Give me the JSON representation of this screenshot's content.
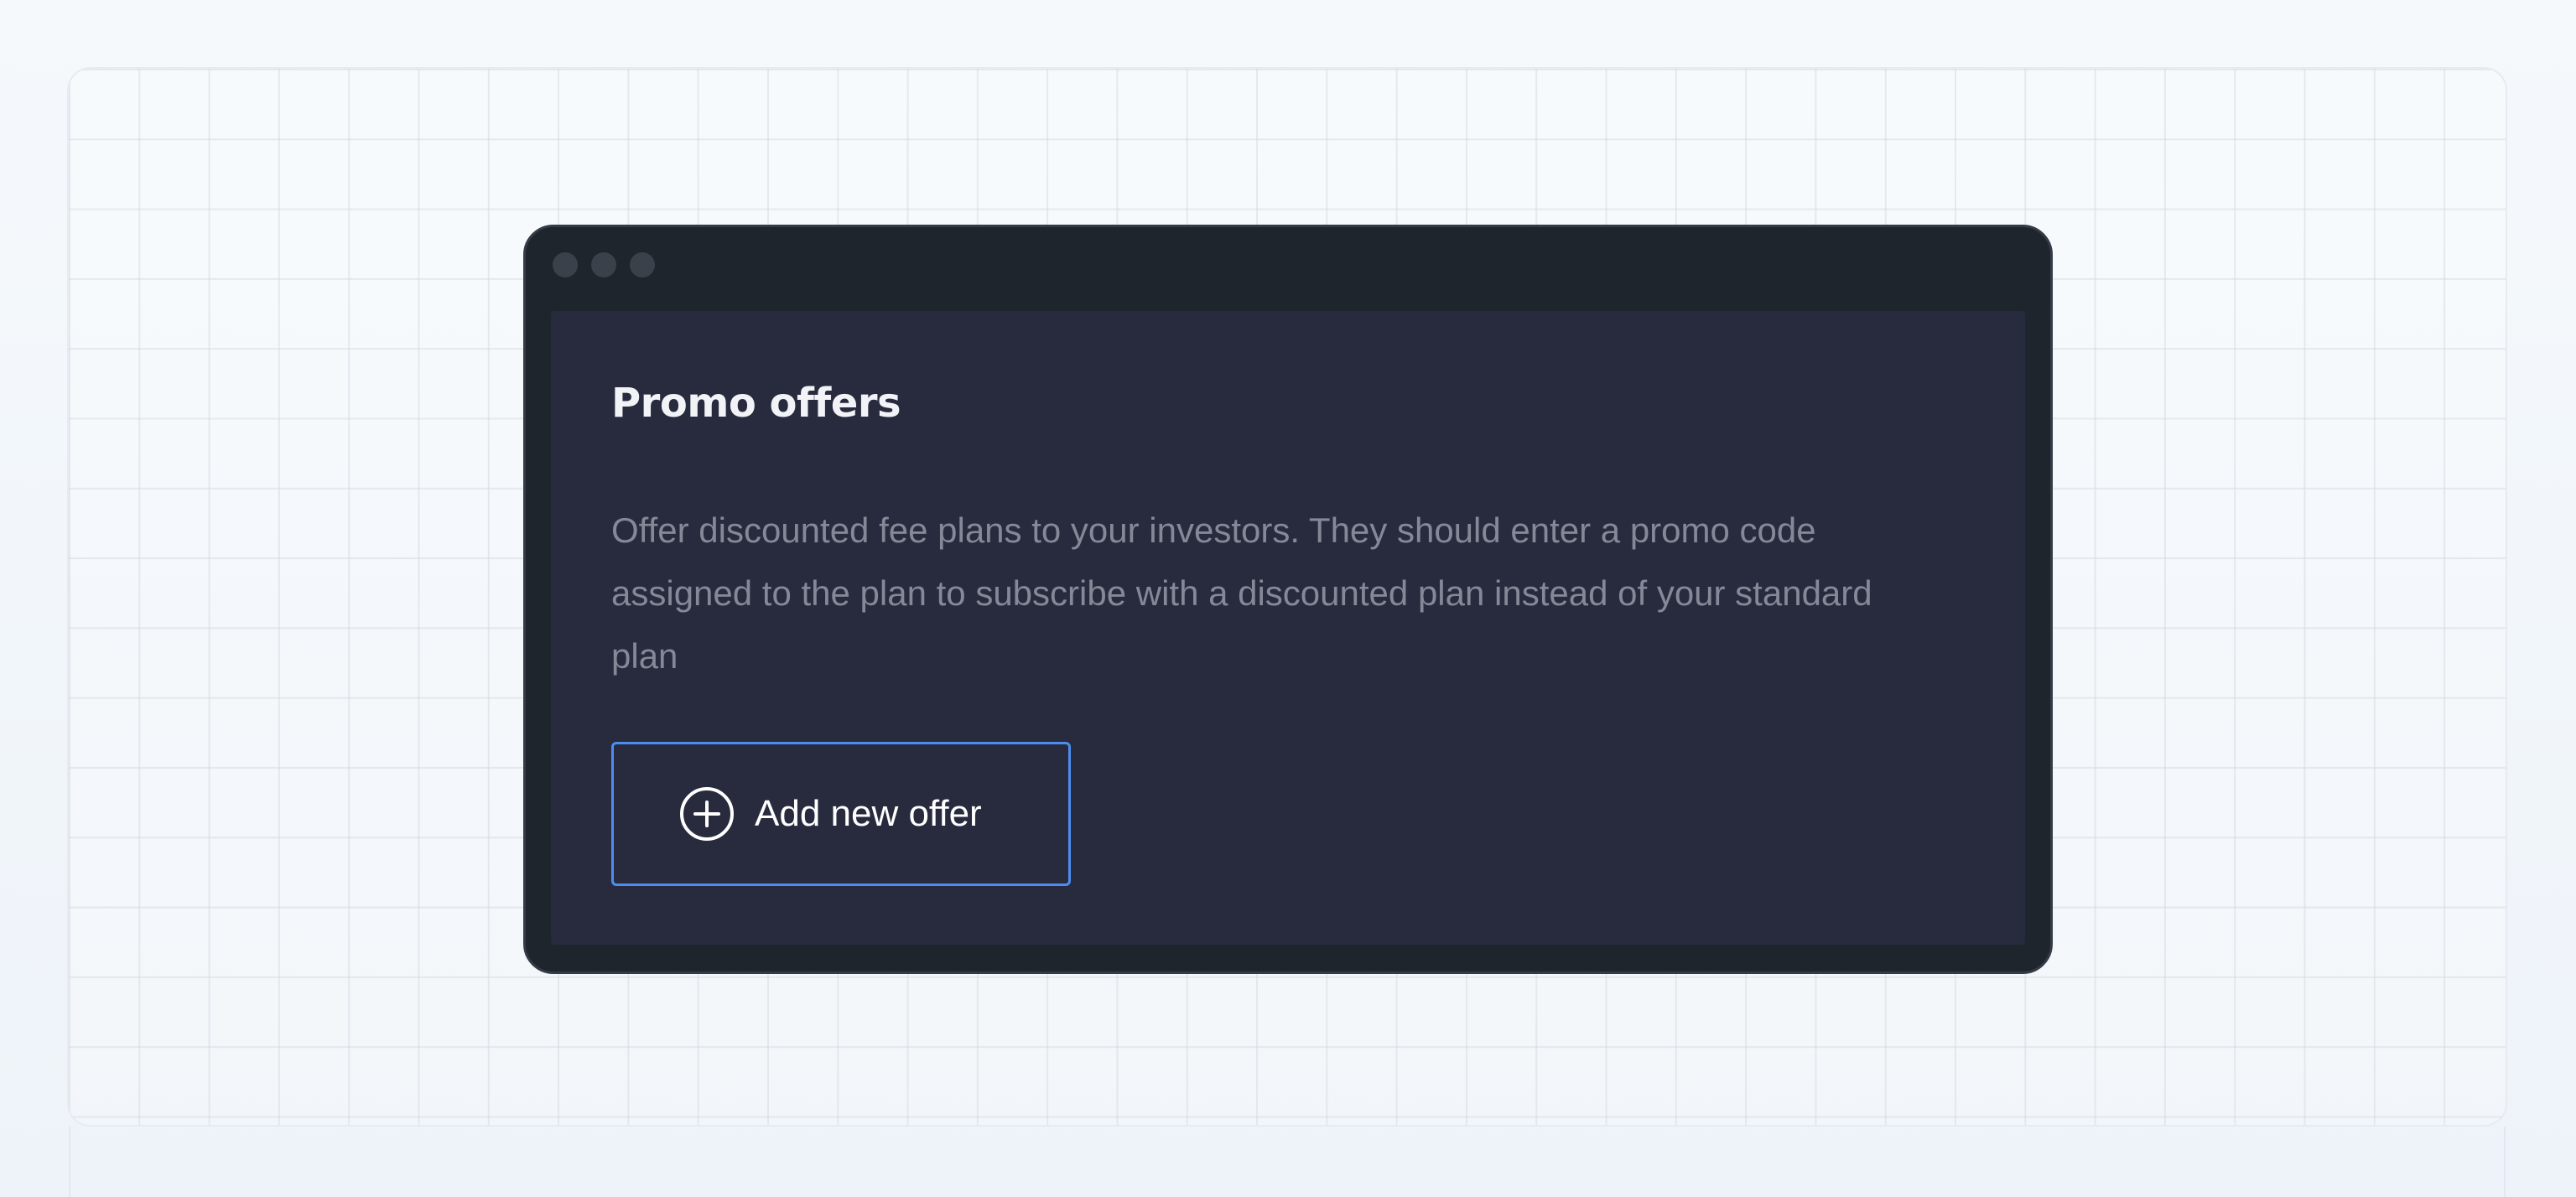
{
  "card": {
    "title": "Promo offers",
    "description": "Offer discounted fee plans to your investors. They should enter a promo code assigned to the plan to subscribe with a discounted plan instead of your standard plan",
    "add_button_label": "Add new offer",
    "add_button_icon": "plus-circle-icon"
  },
  "colors": {
    "page_background": "#f2f6fb",
    "window_frame": "#1f252d",
    "panel_background": "#282b3e",
    "title_text": "#f2f3f7",
    "description_text": "#858896",
    "button_border": "#4c8ef0",
    "button_text": "#ffffff"
  }
}
